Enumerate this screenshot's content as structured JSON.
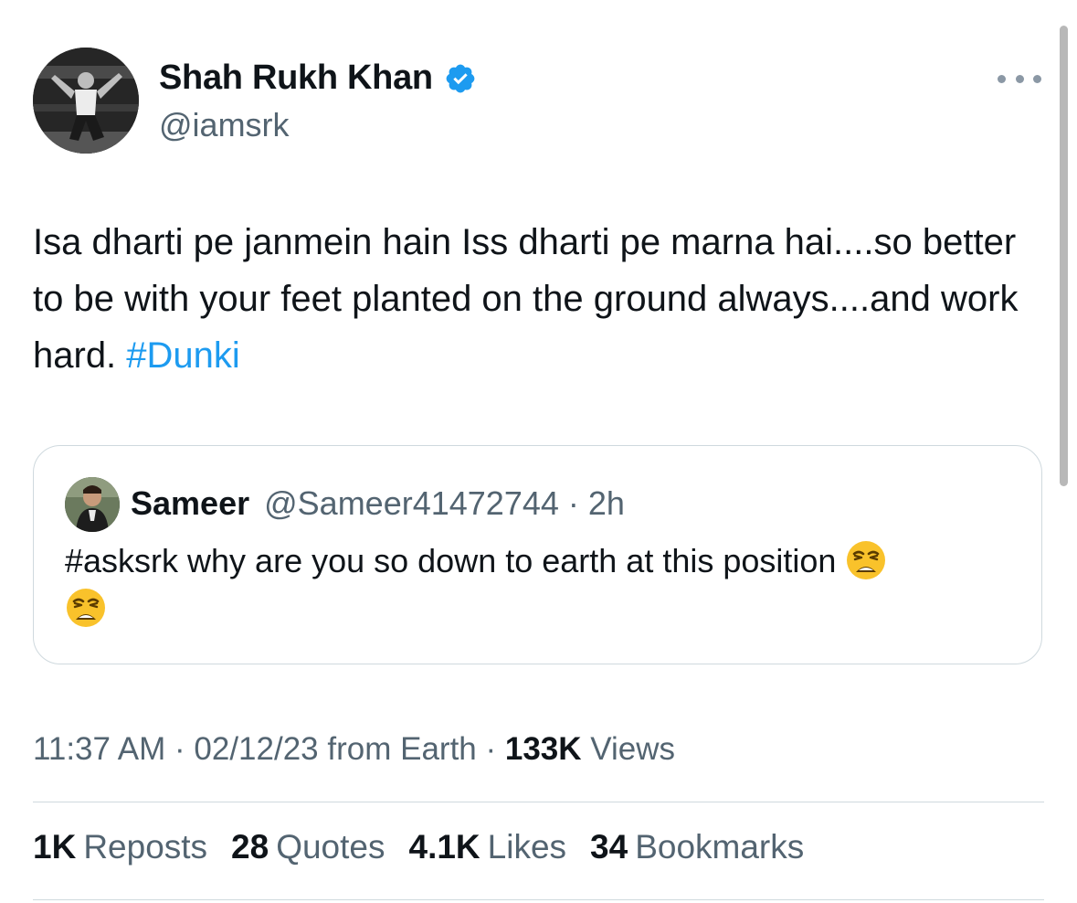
{
  "author": {
    "display_name": "Shah Rukh Khan",
    "handle": "@iamsrk",
    "verified_icon": "verified-badge-icon",
    "avatar_icon": "profile-photo-avatar"
  },
  "more_icon": "more-options-icon",
  "tweet": {
    "text": "Isa dharti pe janmein hain Iss dharti pe marna hai....so better to be with your feet planted on the ground always....and work hard.",
    "hashtag": "#Dunki"
  },
  "quote": {
    "display_name": "Sameer",
    "meta": "@Sameer41472744 · 2h",
    "text": "#asksrk why are you so down to earth at this position",
    "emoji_icon": "weary-face-emoji"
  },
  "meta": {
    "time": "11:37 AM",
    "date": "02/12/23",
    "source": "from Earth",
    "views_count": "133K",
    "views_label": "Views"
  },
  "stats": [
    {
      "count": "1K",
      "label": "Reposts"
    },
    {
      "count": "28",
      "label": "Quotes"
    },
    {
      "count": "4.1K",
      "label": "Likes"
    },
    {
      "count": "34",
      "label": "Bookmarks"
    }
  ],
  "colors": {
    "text": "#0f1419",
    "secondary": "#536471",
    "link": "#1d9bf0",
    "border": "#cfd9de"
  }
}
